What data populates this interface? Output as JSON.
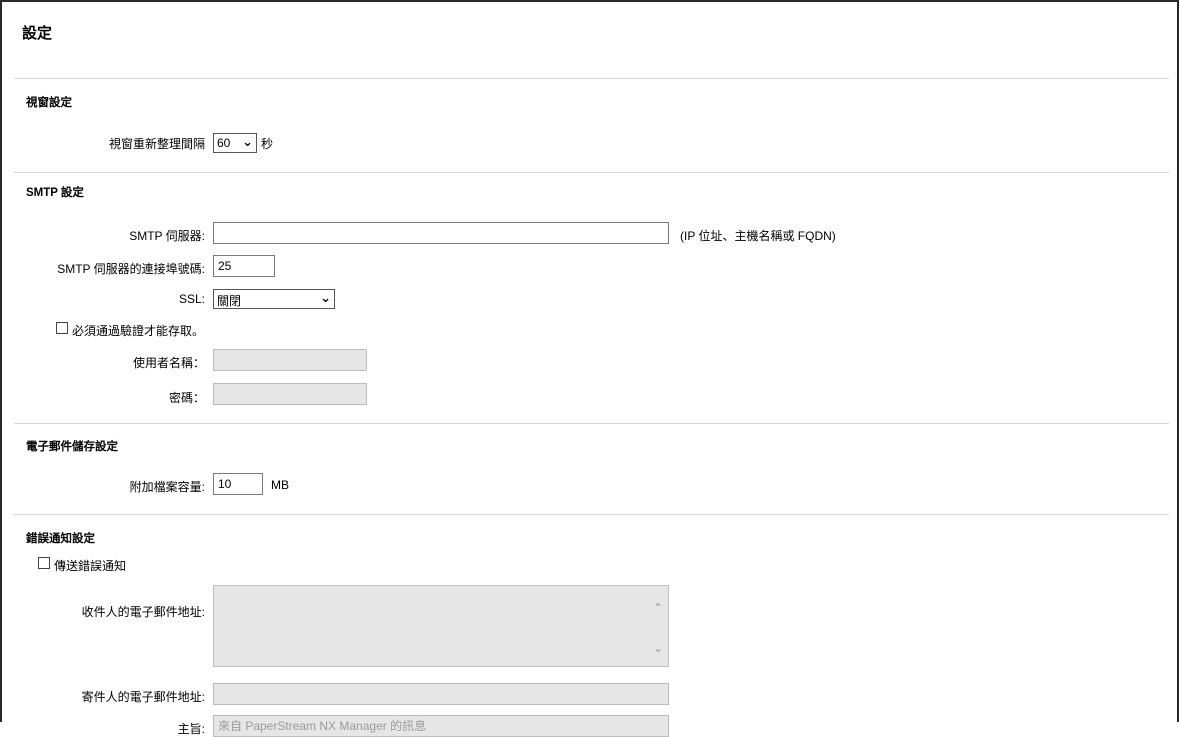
{
  "page": {
    "title": "設定"
  },
  "window_section": {
    "title": "視窗設定",
    "refresh_label": "視窗重新整理間隔",
    "refresh_value": "60",
    "refresh_unit": "秒"
  },
  "smtp_section": {
    "title": "SMTP 設定",
    "server_label": "SMTP 伺服器:",
    "server_value": "",
    "server_hint": "(IP 位址、主機名稱或 FQDN)",
    "port_label": "SMTP 伺服器的連接埠號碼:",
    "port_value": "25",
    "ssl_label": "SSL:",
    "ssl_value": "關閉",
    "auth_checkbox_label": "必須通過驗證才能存取。",
    "auth_checked": false,
    "username_label": "使用者名稱：",
    "username_value": "",
    "password_label": "密碼：",
    "password_value": ""
  },
  "email_storage_section": {
    "title": "電子郵件儲存設定",
    "attachment_label": "附加檔案容量:",
    "attachment_value": "10",
    "attachment_unit": "MB"
  },
  "error_section": {
    "title": "錯誤通知設定",
    "send_checkbox_label": "傳送錯誤通知",
    "send_checked": false,
    "recipient_label": "收件人的電子郵件地址:",
    "recipient_value": "",
    "sender_label": "寄件人的電子郵件地址:",
    "sender_value": "",
    "subject_label": "主旨:",
    "subject_value": "來自 PaperStream NX Manager 的訊息"
  }
}
